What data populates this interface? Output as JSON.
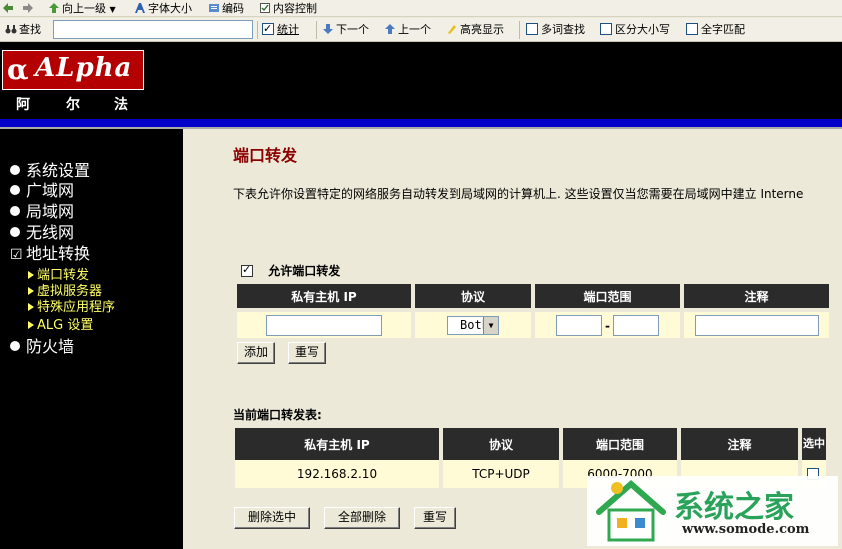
{
  "toolbar": {
    "up_label": "向上一级",
    "font_size_label": "字体大小",
    "encoding_label": "编码",
    "content_control_label": "内容控制"
  },
  "findbar": {
    "find_label": "查找",
    "find_value": "",
    "stats_label": "统计",
    "next_label": "下一个",
    "prev_label": "上一个",
    "highlight_label": "高亮显示",
    "multi_word_label": "多词查找",
    "case_label": "区分大小写",
    "whole_word_label": "全字匹配"
  },
  "brand": {
    "logo_text": "ALpha",
    "cn_chars": [
      "阿",
      "尔",
      "法"
    ]
  },
  "sidebar": {
    "items": [
      {
        "label": "系统设置"
      },
      {
        "label": "广域网"
      },
      {
        "label": "局域网"
      },
      {
        "label": "无线网"
      },
      {
        "label": "地址转换"
      },
      {
        "label": "防火墙"
      }
    ],
    "subitems": [
      {
        "label": "端口转发"
      },
      {
        "label": "虚拟服务器"
      },
      {
        "label": "特殊应用程序"
      },
      {
        "label": "ALG 设置"
      }
    ]
  },
  "main": {
    "title": "端口转发",
    "description": "下表允许你设置特定的网络服务自动转发到局域网的计算机上. 这些设置仅当您需要在局域网中建立  Interne",
    "enable_label": "允许端口转发",
    "form": {
      "headers": [
        "私有主机  IP",
        "协议",
        "端口范围",
        "注释"
      ],
      "ip_value": "",
      "protocol_value": "Both",
      "port_from": "",
      "port_to": "",
      "port_sep": "-",
      "comment_value": "",
      "add_label": "添加",
      "reset_label": "重写"
    },
    "table_title": "当前端口转发表:",
    "table": {
      "headers": [
        "私有主机  IP",
        "协议",
        "端口范围",
        "注释",
        "选中"
      ],
      "rows": [
        {
          "ip": "192.168.2.10",
          "protocol": "TCP+UDP",
          "ports": "6000-7000",
          "comment": ""
        }
      ]
    },
    "delete_selected_label": "删除选中",
    "delete_all_label": "全部删除",
    "reset2_label": "重写"
  },
  "watermark": {
    "name": "系统之家",
    "url": "www.somode.com"
  },
  "colors": {
    "title_red": "#8b0000",
    "nav_blue_bar": "#0000c8",
    "sub_nav_yellow": "#ffff66",
    "watermark_green": "#29a35a"
  }
}
